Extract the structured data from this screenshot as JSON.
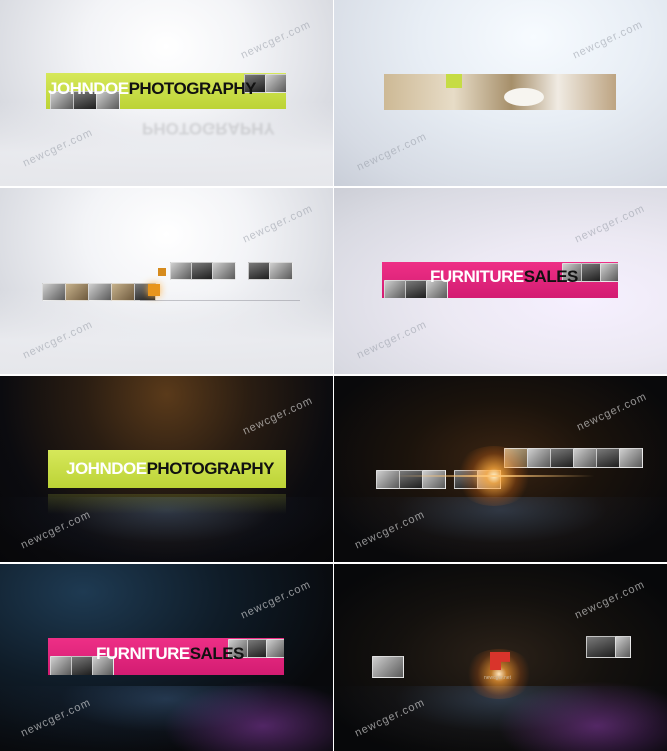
{
  "watermark": "newcger.com",
  "frames": [
    {
      "id": "f1",
      "bar_text_a": "JOHNDOE",
      "bar_text_b": "PHOTOGRAPHY",
      "reflection": "PHOTOGRAPHY"
    },
    {
      "id": "f2"
    },
    {
      "id": "f3"
    },
    {
      "id": "f4",
      "bar_text_a": "FURNITURE",
      "bar_text_b": "SALES"
    },
    {
      "id": "f5",
      "bar_text_a": "JOHNDOE",
      "bar_text_b": "PHOTOGRAPHY"
    },
    {
      "id": "f6"
    },
    {
      "id": "f7",
      "bar_text_a": "FURNITURE",
      "bar_text_b": "SALES"
    },
    {
      "id": "f8",
      "small_url": "newcger.net"
    }
  ],
  "colors": {
    "lime": "#c6dc44",
    "pink": "#e3267c",
    "dark_bg": "#0b0b0f",
    "light_bg": "#e9eaee"
  }
}
